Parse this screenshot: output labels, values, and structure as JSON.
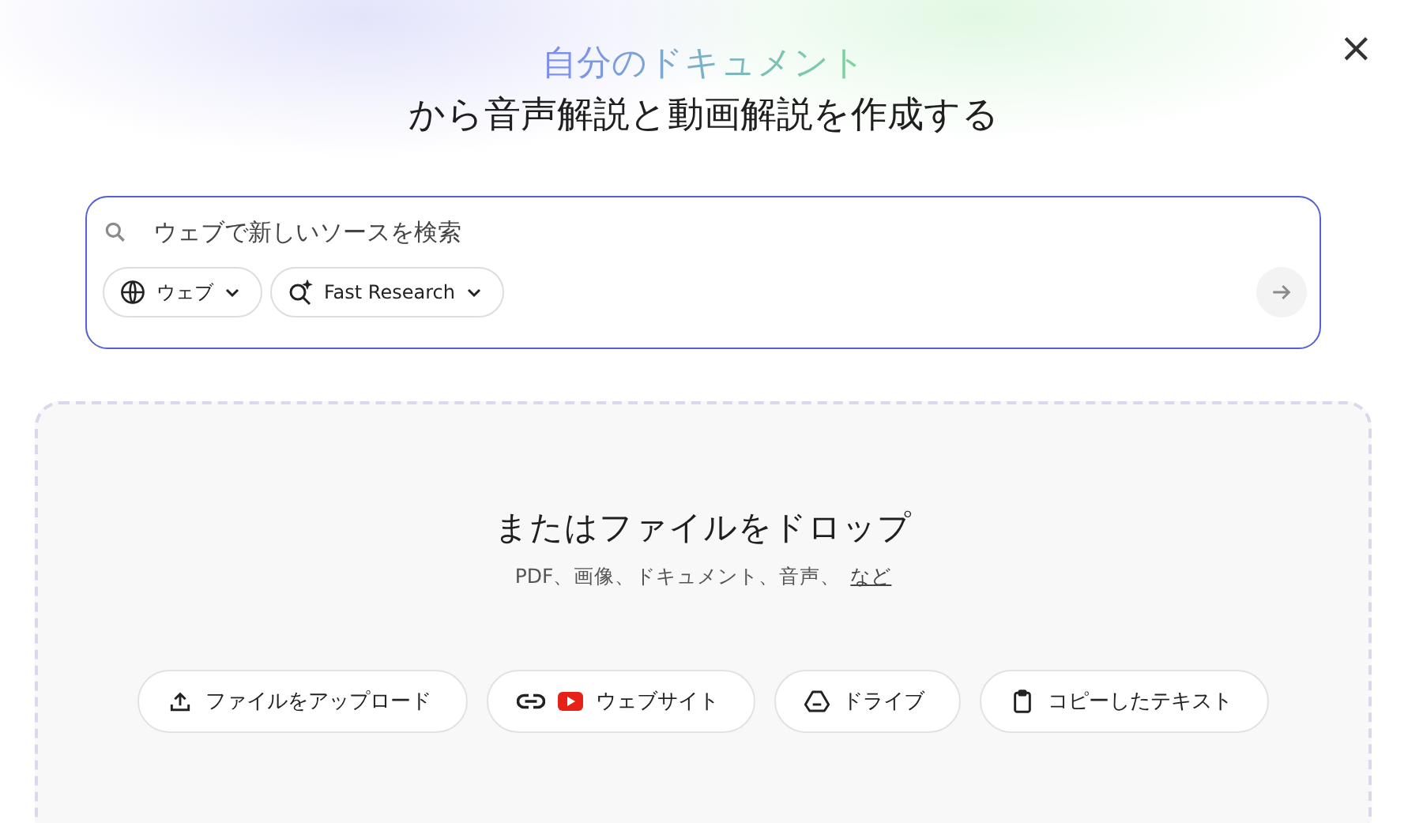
{
  "header": {
    "title_highlight": "自分のドキュメント",
    "title": "から音声解説と動画解説を作成する",
    "close": "×"
  },
  "search": {
    "placeholder": "ウェブで新しいソースを検索",
    "chips": [
      {
        "kind": "web",
        "label": "ウェブ"
      },
      {
        "kind": "research",
        "label": "Fast Research"
      }
    ]
  },
  "dropzone": {
    "title": "またはファイルをドロップ",
    "subtitle": "PDF、画像、ドキュメント、音声、",
    "more_link": "など",
    "buttons": [
      {
        "kind": "upload",
        "label": "ファイルをアップロード"
      },
      {
        "kind": "website",
        "label": "ウェブサイト"
      },
      {
        "kind": "drive",
        "label": "ドライブ"
      },
      {
        "kind": "paste",
        "label": "コピーしたテキスト"
      }
    ]
  }
}
